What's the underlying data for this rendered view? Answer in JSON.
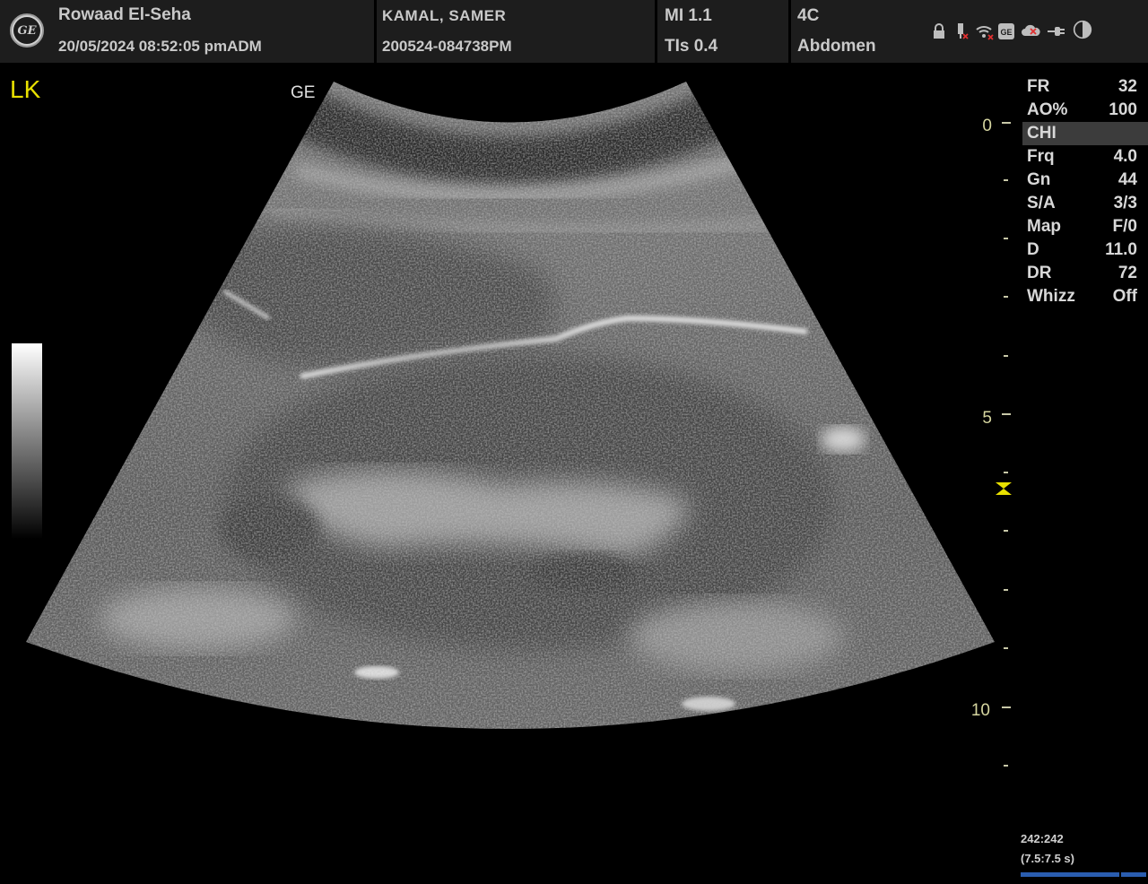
{
  "header": {
    "institution": "Rowaad El-Seha",
    "datetime": "20/05/2024 08:52:05 pmADM",
    "patient_name": "KAMAL, SAMER",
    "exam_id": "200524-084738PM",
    "mi": "MI 1.1",
    "tis": "TIs 0.4",
    "probe": "4C",
    "preset": "Abdomen",
    "logo_text": "GE",
    "status_icons": [
      "lock-icon",
      "usb-icon",
      "wifi-icon",
      "ge-network-icon",
      "cloud-icon",
      "plug-icon",
      "contrast-icon"
    ]
  },
  "image": {
    "orientation_label": "LK",
    "probe_mark": "GE"
  },
  "params": [
    {
      "name": "FR",
      "value": "32"
    },
    {
      "name": "AO%",
      "value": "100"
    },
    {
      "name": "CHI",
      "value": ""
    },
    {
      "name": "Frq",
      "value": "4.0"
    },
    {
      "name": "Gn",
      "value": "44"
    },
    {
      "name": "S/A",
      "value": "3/3"
    },
    {
      "name": "Map",
      "value": "F/0"
    },
    {
      "name": "D",
      "value": "11.0"
    },
    {
      "name": "DR",
      "value": "72"
    },
    {
      "name": "Whizz",
      "value": "Off"
    }
  ],
  "depth_scale": {
    "labels": [
      "0",
      "5",
      "10"
    ]
  },
  "cine": {
    "frames": "242:242",
    "duration": "(7.5:7.5 s)"
  },
  "colors": {
    "header_bg": "#1d1d1d",
    "orientation_label": "#e8e000",
    "depth_labels": "#d6d6a0",
    "cine_bar": "#2a5db0"
  }
}
